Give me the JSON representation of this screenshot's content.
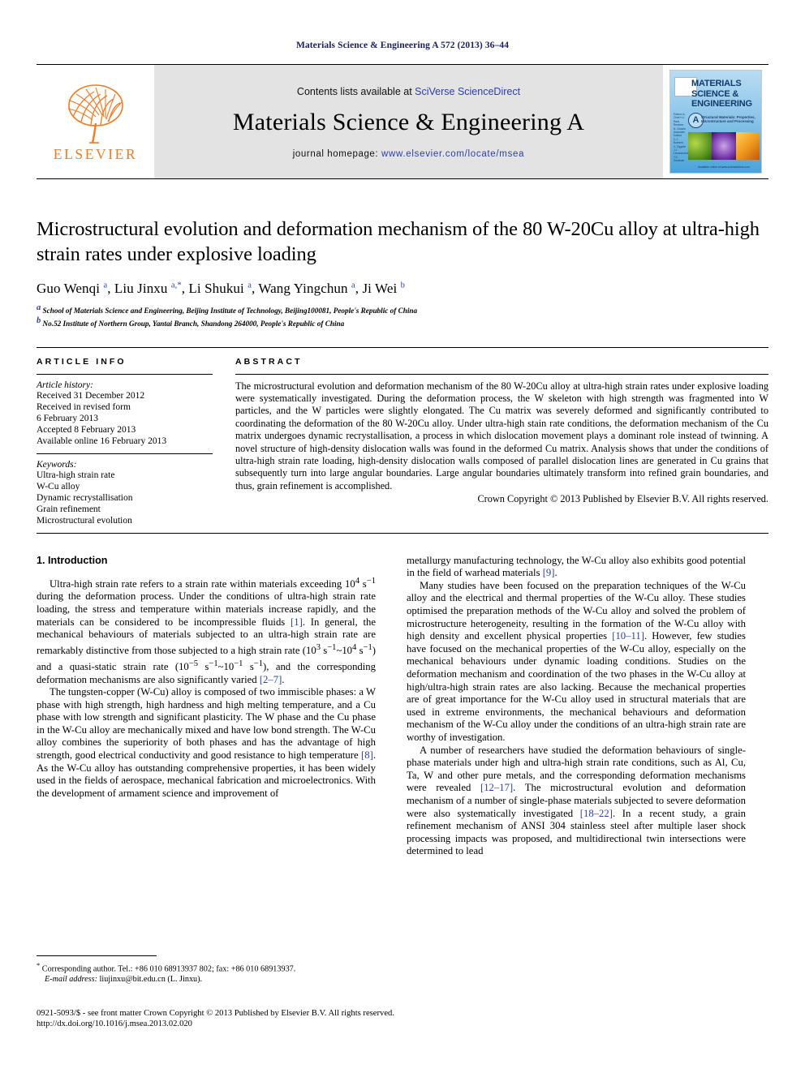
{
  "running_head": "Materials Science & Engineering A 572 (2013) 36–44",
  "masthead": {
    "publisher_name": "ELSEVIER",
    "contents_prefix": "Contents lists available at ",
    "contents_link": "SciVerse ScienceDirect",
    "journal_title": "Materials Science & Engineering A",
    "homepage_prefix": "journal homepage: ",
    "homepage_url": "www.elsevier.com/locate/msea",
    "cover": {
      "title_line1": "MATERIALS",
      "title_line2": "SCIENCE &",
      "title_line3": "ENGINEERING",
      "badge": "A",
      "subtitle": "Structural Materials: Properties, Microstructure and Processing",
      "left_column": "Editors-in-Chief H.J. Rack Reviews N. Chawla Associate Editors C.J. Boehlert G. Eggeler J.J. Lewandowski T.S. Srivatsan",
      "bottom_note": "Available online at www.sciencedirect.com"
    }
  },
  "article": {
    "title": "Microstructural evolution and deformation mechanism of the 80 W-20Cu alloy at ultra-high strain rates under explosive loading",
    "authors_html": "Guo Wenqi <sup>a</sup>, Liu Jinxu <sup>a,</sup><sup>*</sup>, Li Shukui <sup>a</sup>, Wang Yingchun <sup>a</sup>, Ji Wei <sup>b</sup>",
    "affiliations": [
      "School of Materials Science and Engineering, Beijing Institute of Technology, Beijing100081, People's Republic of China",
      "No.52 Institute of Northern Group, Yantai Branch, Shandong 264000, People's Republic of China"
    ],
    "affiliation_marks": [
      "a",
      "b"
    ]
  },
  "article_info": {
    "label": "ARTICLE INFO",
    "history_title": "Article history:",
    "history": [
      "Received 31 December 2012",
      "Received in revised form",
      "6 February 2013",
      "Accepted 8 February 2013",
      "Available online 16 February 2013"
    ],
    "keywords_title": "Keywords:",
    "keywords": [
      "Ultra-high strain rate",
      "W-Cu alloy",
      "Dynamic recrystallisation",
      "Grain refinement",
      "Microstructural evolution"
    ]
  },
  "abstract": {
    "label": "ABSTRACT",
    "text": "The microstructural evolution and deformation mechanism of the 80 W-20Cu alloy at ultra-high strain rates under explosive loading were systematically investigated. During the deformation process, the W skeleton with high strength was fragmented into W particles, and the W particles were slightly elongated. The Cu matrix was severely deformed and significantly contributed to coordinating the deformation of the 80 W-20Cu alloy. Under ultra-high stain rate conditions, the deformation mechanism of the Cu matrix undergoes dynamic recrystallisation, a process in which dislocation movement plays a dominant role instead of twinning. A novel structure of high-density dislocation walls was found in the deformed Cu matrix. Analysis shows that under the conditions of ultra-high strain rate loading, high-density dislocation walls composed of parallel dislocation lines are generated in Cu grains that subsequently turn into large angular boundaries. Large angular boundaries ultimately transform into refined grain boundaries, and thus, grain refinement is accomplished.",
    "copyright": "Crown Copyright © 2013 Published by Elsevier B.V. All rights reserved."
  },
  "introduction": {
    "heading": "1. Introduction",
    "left_paragraphs_html": [
      "Ultra-high strain rate refers to a strain rate within materials exceeding 10<sup>4</sup> s<sup>−1</sup> during the deformation process. Under the conditions of ultra-high strain rate loading, the stress and temperature within materials increase rapidly, and the materials can be considered to be incompressible fluids <span class=\"ref\">[1]</span>. In general, the mechanical behaviours of materials subjected to an ultra-high strain rate are remarkably distinctive from those subjected to a high strain rate (10<sup>3</sup> s<sup>−1</sup>~10<sup>4</sup> s<sup>−1</sup>) and a quasi-static strain rate (10<sup>−5</sup> s<sup>−1</sup>~10<sup>−1</sup> s<sup>−1</sup>), and the corresponding deformation mechanisms are also significantly varied <span class=\"ref\">[2–7]</span>.",
      "The tungsten-copper (W-Cu) alloy is composed of two immiscible phases: a W phase with high strength, high hardness and high melting temperature, and a Cu phase with low strength and significant plasticity. The W phase and the Cu phase in the W-Cu alloy are mechanically mixed and have low bond strength. The W-Cu alloy combines the superiority of both phases and has the advantage of high strength, good electrical conductivity and good resistance to high temperature <span class=\"ref\">[8]</span>. As the W-Cu alloy has outstanding comprehensive properties, it has been widely used in the fields of aerospace, mechanical fabrication and microelectronics. With the development of armament science and improvement of"
    ],
    "right_paragraphs_html": [
      "metallurgy manufacturing technology, the W-Cu alloy also exhibits good potential in the field of warhead materials <span class=\"ref\">[9]</span>.",
      "Many studies have been focused on the preparation techniques of the W-Cu alloy and the electrical and thermal properties of the W-Cu alloy. These studies optimised the preparation methods of the W-Cu alloy and solved the problem of microstructure heterogeneity, resulting in the formation of the W-Cu alloy with high density and excellent physical properties <span class=\"ref\">[10–11]</span>. However, few studies have focused on the mechanical properties of the W-Cu alloy, especially on the mechanical behaviours under dynamic loading conditions. Studies on the deformation mechanism and coordination of the two phases in the W-Cu alloy at high/ultra-high strain rates are also lacking. Because the mechanical properties are of great importance for the W-Cu alloy used in structural materials that are used in extreme environments, the mechanical behaviours and deformation mechanism of the W-Cu alloy under the conditions of an ultra-high strain rate are worthy of investigation.",
      "A number of researchers have studied the deformation behaviours of single-phase materials under high and ultra-high strain rate conditions, such as Al, Cu, Ta, W and other pure metals, and the corresponding deformation mechanisms were revealed <span class=\"ref\">[12–17]</span>. The microstructural evolution and deformation mechanism of a number of single-phase materials subjected to severe deformation were also systematically investigated <span class=\"ref\">[18–22]</span>. In a recent study, a grain refinement mechanism of ANSI 304 stainless steel after multiple laser shock processing impacts was proposed, and multidirectional twin intersections were determined to lead"
    ]
  },
  "footnote": {
    "corresponding_html": "<sup>*</sup> Corresponding author. Tel.: +86 010 68913937 802; fax: +86 010 68913937.",
    "email_label": "E-mail address:",
    "email_value": "liujinxu@bit.edu.cn (L. Jinxu)."
  },
  "footer": {
    "issn_line": "0921-5093/$ - see front matter Crown Copyright © 2013 Published by Elsevier B.V. All rights reserved.",
    "doi_line": "http://dx.doi.org/10.1016/j.msea.2013.02.020"
  },
  "colors": {
    "link_blue": "#2b3faa",
    "running_head_navy": "#1b2060",
    "elsevier_orange": "#f47920",
    "masthead_gray": "#e3e3e3"
  }
}
